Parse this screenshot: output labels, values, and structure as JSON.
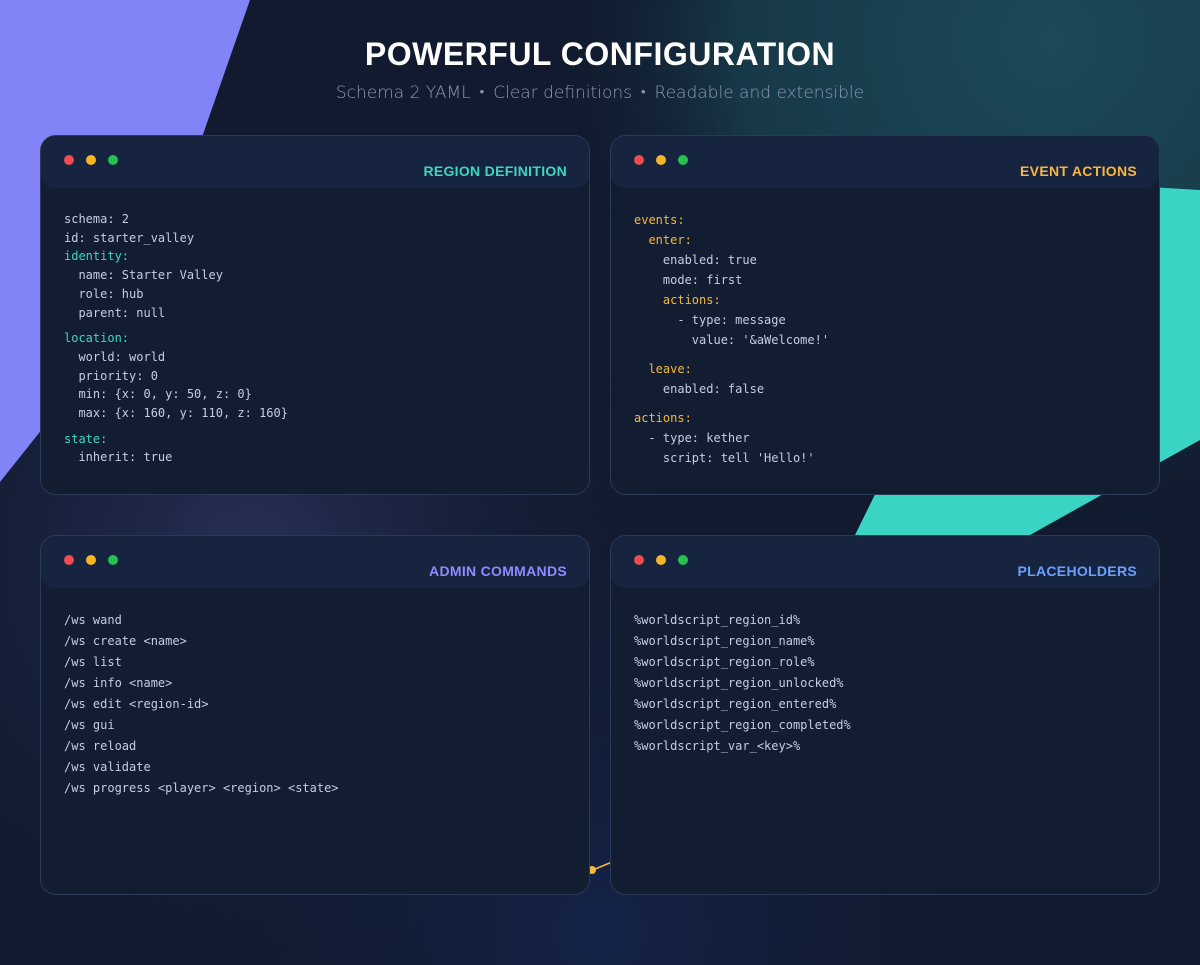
{
  "header": {
    "title": "POWERFUL CONFIGURATION",
    "subtitle_items": [
      "Schema 2 YAML",
      "Clear definitions",
      "Readable and extensible"
    ],
    "separator": "•"
  },
  "colors": {
    "background": "#111a2e",
    "accent_teal": "#3dd6c0",
    "accent_amber": "#f6b73c",
    "accent_violet": "#8b8cff",
    "accent_blue": "#6aa0ff",
    "dot_red": "#ef4b52",
    "dot_yellow": "#f5b524",
    "dot_green": "#26c04e"
  },
  "cards": {
    "region": {
      "title": "REGION DEFINITION",
      "lines": [
        "schema: 2",
        "id: starter_valley",
        "identity:",
        "  name: Starter Valley",
        "  role: hub",
        "  parent: null",
        "location:",
        "  world: world",
        "  priority: 0",
        "  min: {x: 0, y: 50, z: 0}",
        "  max: {x: 160, y: 110, z: 160}",
        "state:",
        "  inherit: true"
      ]
    },
    "events": {
      "title": "EVENT ACTIONS",
      "lines": [
        "events:",
        "  enter:",
        "    enabled: true",
        "    mode: first",
        "    actions:",
        "      - type: message",
        "        value: '&aWelcome!'",
        "  leave:",
        "    enabled: false",
        "actions:",
        "  - type: kether",
        "    script: tell 'Hello!'"
      ]
    },
    "admin": {
      "title": "ADMIN COMMANDS",
      "lines": [
        "/ws wand",
        "/ws create <name>",
        "/ws list",
        "/ws info <name>",
        "/ws edit <region-id>",
        "/ws gui",
        "/ws reload",
        "/ws validate",
        "/ws progress <player> <region> <state>"
      ]
    },
    "placeholders": {
      "title": "PLACEHOLDERS",
      "lines": [
        "%worldscript_region_id%",
        "%worldscript_region_name%",
        "%worldscript_region_role%",
        "%worldscript_region_unlocked%",
        "%worldscript_region_entered%",
        "%worldscript_region_completed%",
        "%worldscript_var_<key>%"
      ]
    }
  }
}
